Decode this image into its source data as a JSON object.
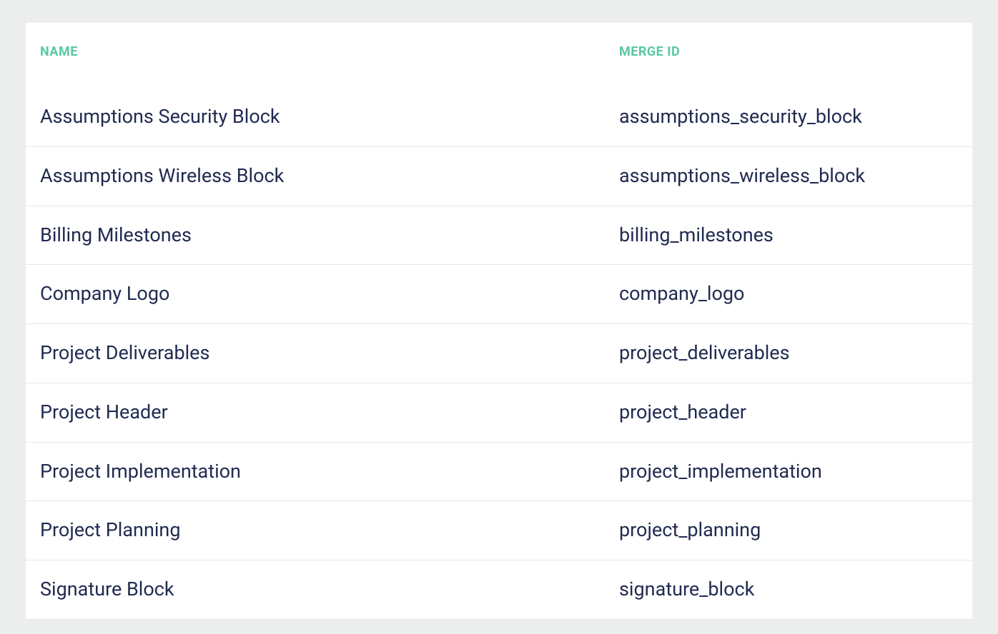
{
  "table": {
    "columns": {
      "name": "NAME",
      "merge_id": "MERGE ID"
    },
    "rows": [
      {
        "name": "Assumptions Security Block",
        "merge_id": "assumptions_security_block"
      },
      {
        "name": "Assumptions Wireless Block",
        "merge_id": "assumptions_wireless_block"
      },
      {
        "name": "Billing Milestones",
        "merge_id": "billing_milestones"
      },
      {
        "name": "Company Logo",
        "merge_id": "company_logo"
      },
      {
        "name": "Project Deliverables",
        "merge_id": "project_deliverables"
      },
      {
        "name": "Project Header",
        "merge_id": "project_header"
      },
      {
        "name": "Project Implementation",
        "merge_id": "project_implementation"
      },
      {
        "name": "Project Planning",
        "merge_id": "project_planning"
      },
      {
        "name": "Signature Block",
        "merge_id": "signature_block"
      }
    ]
  }
}
